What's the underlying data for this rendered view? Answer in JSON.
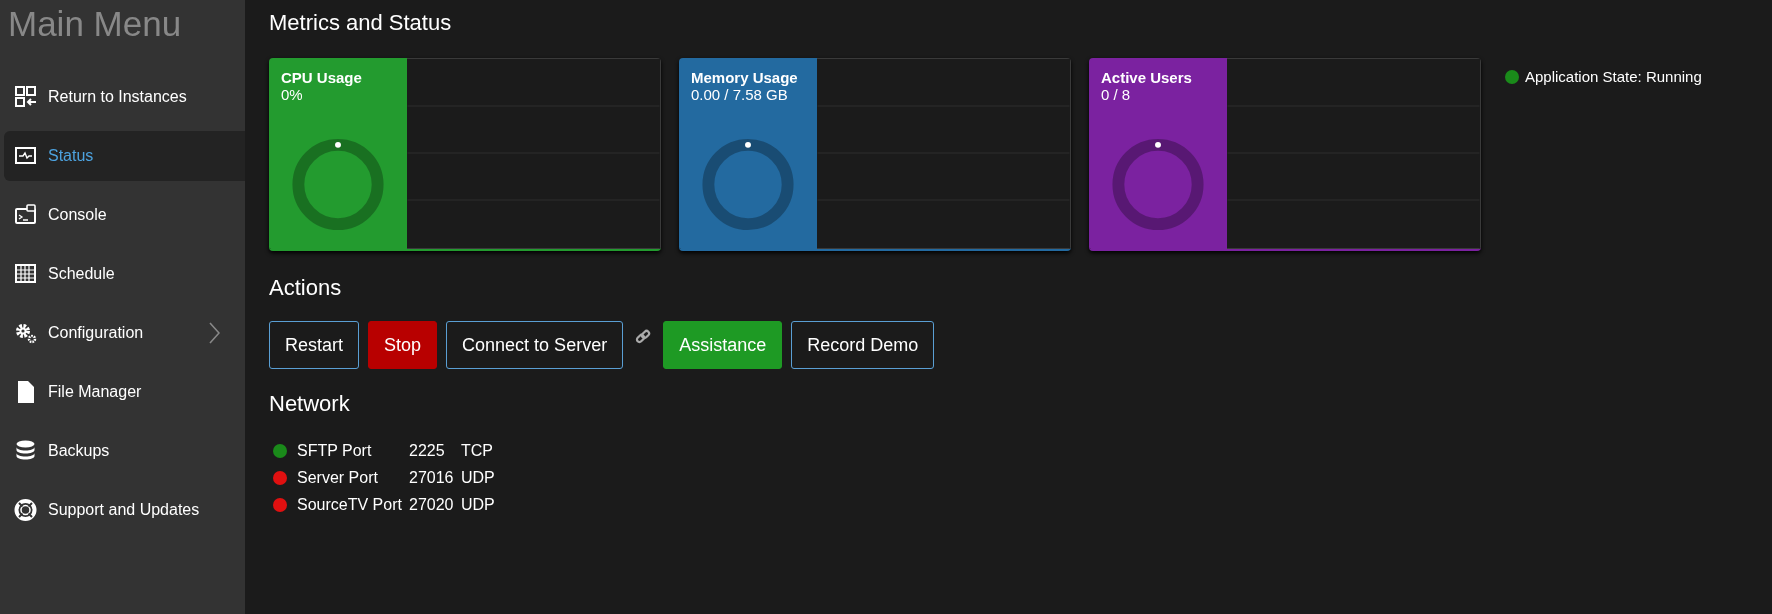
{
  "sidebar": {
    "title": "Main Menu",
    "items": [
      {
        "label": "Return to Instances",
        "kind": "instances",
        "selected": false,
        "expandable": false
      },
      {
        "label": "Status",
        "kind": "status",
        "selected": true,
        "expandable": false
      },
      {
        "label": "Console",
        "kind": "console",
        "selected": false,
        "expandable": false
      },
      {
        "label": "Schedule",
        "kind": "schedule",
        "selected": false,
        "expandable": false
      },
      {
        "label": "Configuration",
        "kind": "config",
        "selected": false,
        "expandable": true
      },
      {
        "label": "File Manager",
        "kind": "file",
        "selected": false,
        "expandable": false
      },
      {
        "label": "Backups",
        "kind": "backups",
        "selected": false,
        "expandable": false
      },
      {
        "label": "Support and Updates",
        "kind": "support",
        "selected": false,
        "expandable": false
      }
    ]
  },
  "metrics": {
    "heading": "Metrics and Status",
    "cards": [
      {
        "title": "CPU Usage",
        "value": "0%",
        "color": "#239b2f",
        "level": 0
      },
      {
        "title": "Memory Usage",
        "value": "0.00 / 7.58 GB",
        "color": "#236aa0",
        "level": 0
      },
      {
        "title": "Active Users",
        "value": "0 / 8",
        "color": "#7b22a0",
        "level": 0
      }
    ],
    "app_state": {
      "label": "Application State: Running",
      "color": "#1a8a1a"
    }
  },
  "actions": {
    "heading": "Actions",
    "buttons": [
      {
        "label": "Restart",
        "kind": "outline"
      },
      {
        "label": "Stop",
        "kind": "danger"
      },
      {
        "label": "Connect to Server",
        "kind": "outline"
      },
      {
        "kind": "link"
      },
      {
        "label": "Assistance",
        "kind": "success"
      },
      {
        "label": "Record Demo",
        "kind": "outline"
      }
    ]
  },
  "network": {
    "heading": "Network",
    "ports": [
      {
        "name": "SFTP Port",
        "port": "2225",
        "protocol": "TCP",
        "color": "#1a8a1a"
      },
      {
        "name": "Server Port",
        "port": "27016",
        "protocol": "UDP",
        "color": "#e01010"
      },
      {
        "name": "SourceTV Port",
        "port": "27020",
        "protocol": "UDP",
        "color": "#e01010"
      }
    ]
  }
}
